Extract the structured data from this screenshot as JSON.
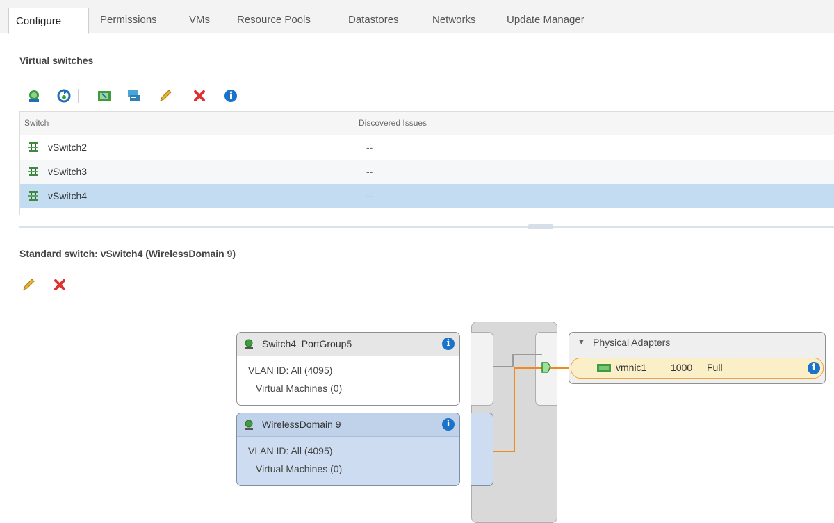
{
  "tabs": [
    {
      "label": "Configure",
      "active": true
    },
    {
      "label": "Permissions",
      "active": false
    },
    {
      "label": "VMs",
      "active": false
    },
    {
      "label": "Resource Pools",
      "active": false
    },
    {
      "label": "Datastores",
      "active": false
    },
    {
      "label": "Networks",
      "active": false
    },
    {
      "label": "Update Manager",
      "active": false
    }
  ],
  "virtual_switches": {
    "title": "Virtual switches",
    "toolbar_icons": [
      "add-networking-icon",
      "refresh-icon",
      "add-host-networking-icon",
      "migrate-icon",
      "edit-pencil-icon",
      "delete-x-icon",
      "info-icon"
    ],
    "columns": [
      "Switch",
      "Discovered Issues"
    ],
    "rows": [
      {
        "name": "vSwitch2",
        "issues": "--",
        "selected": false
      },
      {
        "name": "vSwitch3",
        "issues": "--",
        "selected": false
      },
      {
        "name": "vSwitch4",
        "issues": "--",
        "selected": true
      }
    ]
  },
  "standard_switch": {
    "title": "Standard switch: vSwitch4 (WirelessDomain 9)",
    "toolbar_icons": [
      "edit-pencil-icon",
      "delete-x-icon"
    ],
    "port_groups": [
      {
        "name": "Switch4_PortGroup5",
        "vlan": "VLAN ID: All (4095)",
        "vms": "Virtual Machines (0)",
        "selected": false
      },
      {
        "name": "WirelessDomain 9",
        "vlan": "VLAN ID: All (4095)",
        "vms": "Virtual Machines (0)",
        "selected": true
      }
    ],
    "physical_adapters": {
      "title": "Physical Adapters",
      "adapters": [
        {
          "name": "vmnic1",
          "speed": "1000",
          "duplex": "Full"
        }
      ]
    },
    "colors": {
      "connection": "#f08a1c",
      "selected": "#cddcf0",
      "info": "#1a73c9"
    }
  }
}
